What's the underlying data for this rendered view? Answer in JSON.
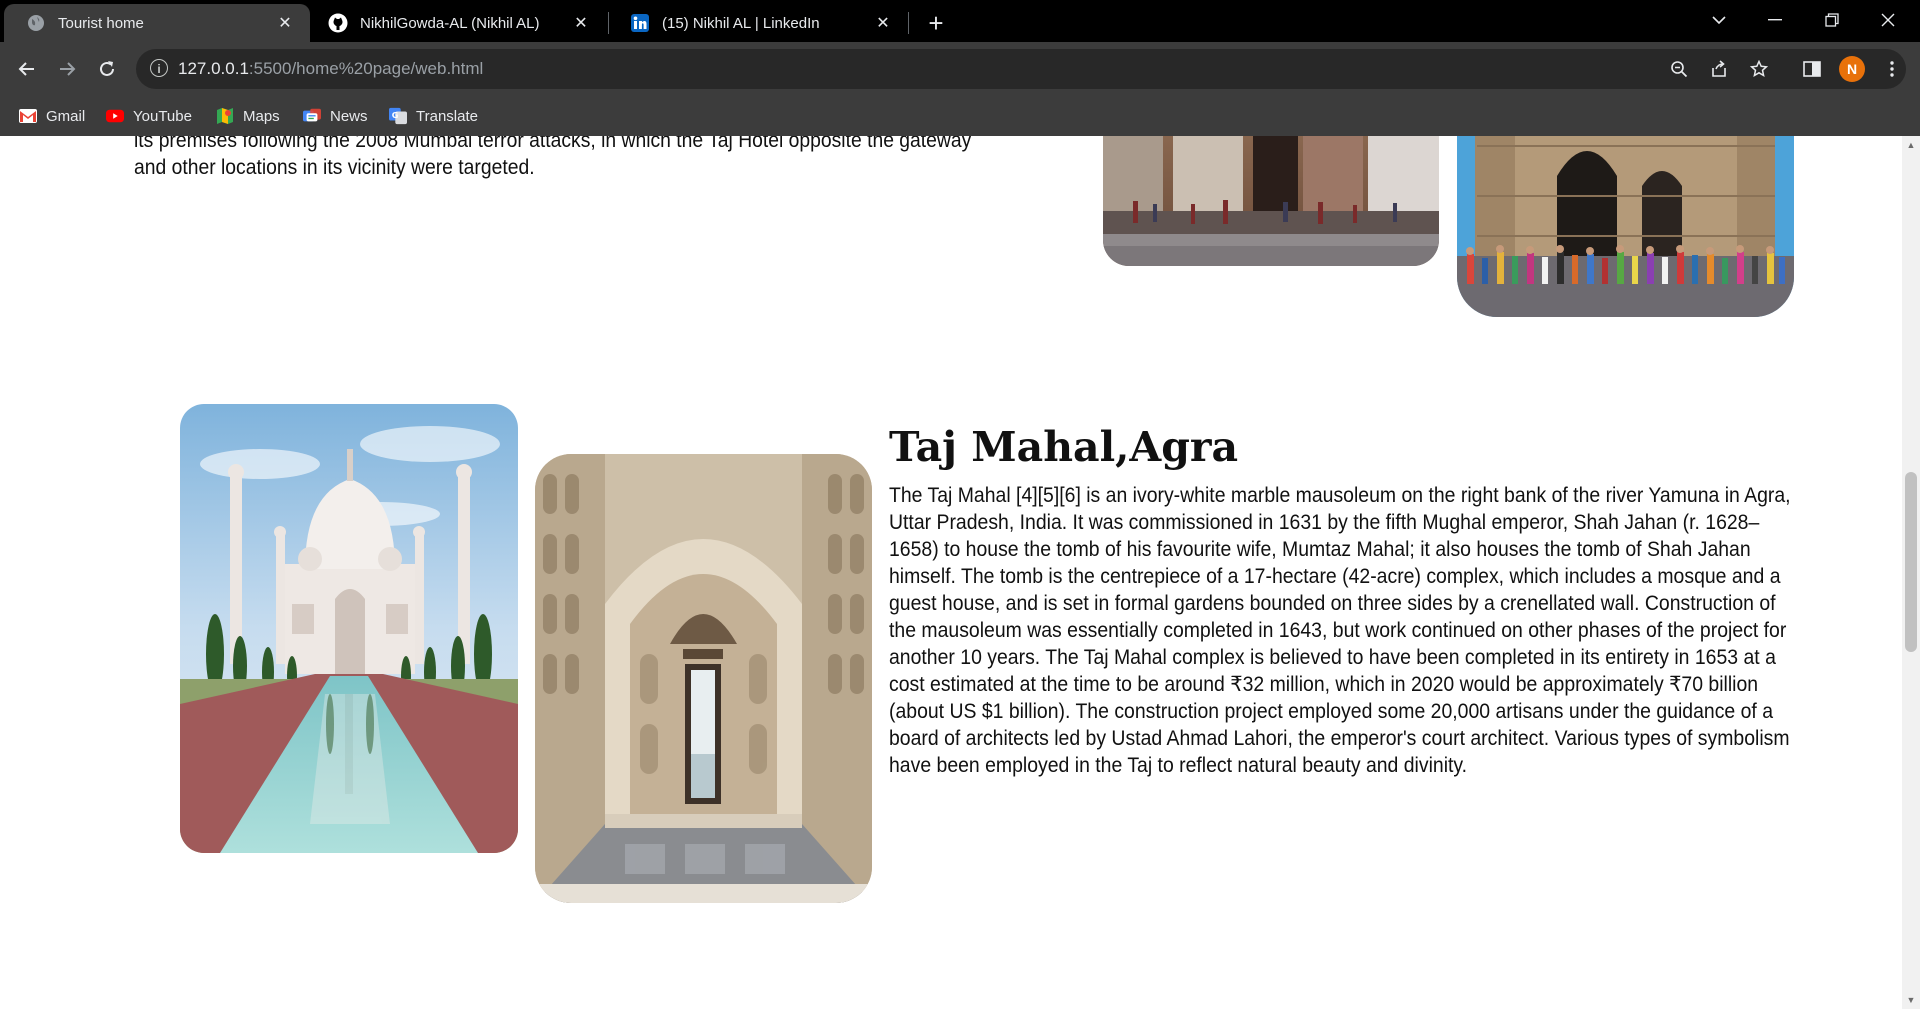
{
  "browser": {
    "tabs": [
      {
        "title": "Tourist home",
        "icon": "globe-icon",
        "active": true
      },
      {
        "title": "NikhilGowda-AL (Nikhil AL)",
        "icon": "github-icon",
        "active": false
      },
      {
        "title": "(15) Nikhil AL | LinkedIn",
        "icon": "linkedin-icon",
        "active": false
      }
    ],
    "address": {
      "host": "127.0.0.1",
      "path": ":5500/home%20page/web.html"
    },
    "profile_initial": "N",
    "bookmarks": [
      {
        "label": "Gmail",
        "icon": "gmail-icon"
      },
      {
        "label": "YouTube",
        "icon": "youtube-icon"
      },
      {
        "label": "Maps",
        "icon": "maps-icon"
      },
      {
        "label": "News",
        "icon": "news-icon"
      },
      {
        "label": "Translate",
        "icon": "translate-icon"
      }
    ]
  },
  "page": {
    "gateway_text": "its premises following the 2008 Mumbai terror attacks, in which the Taj Hotel opposite the gateway and other locations in its vicinity were targeted.",
    "taj": {
      "heading": "Taj Mahal,Agra",
      "paragraph": "The Taj Mahal [4][5][6] is an ivory-white marble mausoleum on the right bank of the river Yamuna in Agra, Uttar Pradesh, India. It was commissioned in 1631 by the fifth Mughal emperor, Shah Jahan (r. 1628–1658) to house the tomb of his favourite wife, Mumtaz Mahal; it also houses the tomb of Shah Jahan himself. The tomb is the centrepiece of a 17-hectare (42-acre) complex, which includes a mosque and a guest house, and is set in formal gardens bounded on three sides by a crenellated wall. Construction of the mausoleum was essentially completed in 1643, but work continued on other phases of the project for another 10 years. The Taj Mahal complex is believed to have been completed in its entirety in 1653 at a cost estimated at the time to be around ₹32 million, which in 2020 would be approximately ₹70 billion (about US $1 billion). The construction project employed some 20,000 artisans under the guidance of a board of architects led by Ustad Ahmad Lahori, the emperor's court architect. Various types of symbolism have been employed in the Taj to reflect natural beauty and divinity."
    }
  }
}
